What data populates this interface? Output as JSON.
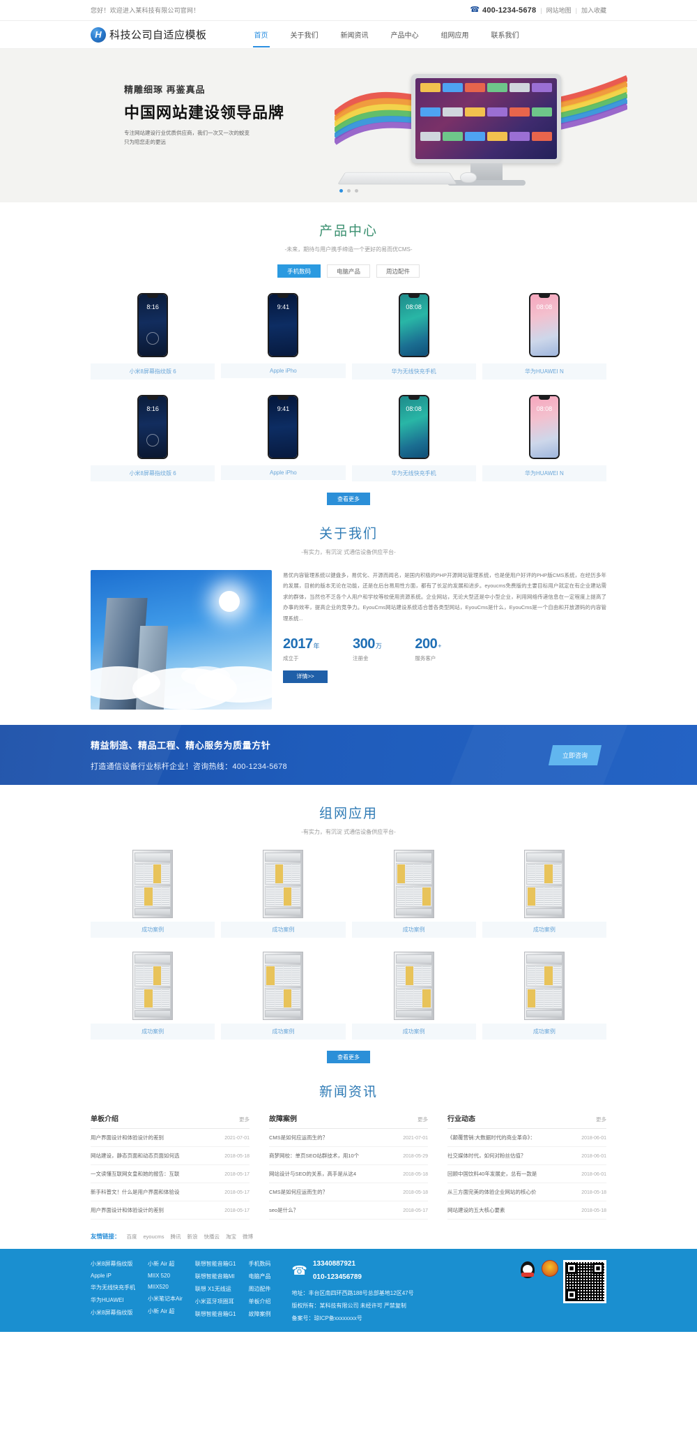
{
  "topbar": {
    "welcome": "您好！欢迎进入某科技有限公司官网！",
    "phone_icon": "phone-icon",
    "phone": "400-1234-5678",
    "sitemap": "网站地图",
    "favorite": "加入收藏",
    "sep": "|"
  },
  "header": {
    "logo_mark": "H",
    "logo_text": "科技公司自适应模板",
    "nav": [
      {
        "label": "首页",
        "active": true
      },
      {
        "label": "关于我们",
        "active": false
      },
      {
        "label": "新闻资讯",
        "active": false
      },
      {
        "label": "产品中心",
        "active": false
      },
      {
        "label": "组网应用",
        "active": false
      },
      {
        "label": "联系我们",
        "active": false
      }
    ]
  },
  "banner": {
    "subtitle": "精雕细琢 再鉴真品",
    "title": "中国网站建设领导品牌",
    "desc_line1": "专注网站建设行业优质供应商，我们一次又一次的蜕变",
    "desc_line2": "只为陪您走的更远",
    "screen_time": "",
    "dots": 3,
    "active_dot": 0
  },
  "products": {
    "title": "产品中心",
    "subtitle": "-未来，期待与用户携手缔造一个更好的易而优CMS-",
    "tabs": [
      {
        "label": "手机数码",
        "active": true
      },
      {
        "label": "电脑产品",
        "active": false
      },
      {
        "label": "周边配件",
        "active": false
      }
    ],
    "items": [
      {
        "name": "小米8屏幕指纹版 6",
        "style": "ph-xiaomi",
        "time": "8:16"
      },
      {
        "name": "Apple iPho",
        "style": "ph-iphone",
        "time": "9:41"
      },
      {
        "name": "华为无线快充手机",
        "style": "ph-huawei1",
        "time": "08:08"
      },
      {
        "name": "华为HUAWEI N",
        "style": "ph-huawei2",
        "time": "08:08"
      },
      {
        "name": "小米8屏幕指纹版 6",
        "style": "ph-xiaomi",
        "time": "8:16"
      },
      {
        "name": "Apple iPho",
        "style": "ph-iphone",
        "time": "9:41"
      },
      {
        "name": "华为无线快充手机",
        "style": "ph-huawei1",
        "time": "08:08"
      },
      {
        "name": "华为HUAWEI N",
        "style": "ph-huawei2",
        "time": "08:08"
      }
    ],
    "more": "查看更多"
  },
  "about": {
    "title": "关于我们",
    "subtitle": "-有实力，有沉淀 式通信设备供应平台-",
    "paragraph": "易优内容管理系统以键盘多，易优化、开源而闻名，是国内积极的PHP开源网站管理系统，也是使用户好评的PHP版CMS系统，在经历多年的发展，目前的版本无论在功能，还是在后台易用性方面，都有了长足的发展和进步。eyoucms免费版的主要目标用户就定在有企业建站需求的群体，当然也不乏各个人用户和学校等校使用资源系统。企业网站，无论大型还是中小型企业，利用网络传递信息在一定程度上提高了办事的效率，提高企业的竞争力。EyouCms网站建设系统适合普各类型网站，EyouCms是什么，EyouCms是一个自由和开放源码的内容管理系统...",
    "stats": [
      {
        "number": "2017",
        "unit": "年",
        "label": "成立于"
      },
      {
        "number": "300",
        "unit": "万",
        "label": "注册金"
      },
      {
        "number": "200",
        "unit": "+",
        "label": "服务客户"
      }
    ],
    "detail_btn": "详情>>"
  },
  "cta": {
    "line1": "精益制造、精品工程、精心服务为质量方针",
    "line2": "打造通信设备行业标杆企业！咨询热线：400-1234-5678",
    "button": "立即咨询"
  },
  "network": {
    "title": "组网应用",
    "subtitle": "-有实力，有沉淀 式通信设备供应平台-",
    "items": [
      {
        "name": "成功案例"
      },
      {
        "name": "成功案例"
      },
      {
        "name": "成功案例"
      },
      {
        "name": "成功案例"
      },
      {
        "name": "成功案例"
      },
      {
        "name": "成功案例"
      },
      {
        "name": "成功案例"
      },
      {
        "name": "成功案例"
      }
    ],
    "more": "查看更多"
  },
  "news": {
    "title": "新闻资讯",
    "more_label": "更多",
    "columns": [
      {
        "title": "单板介绍",
        "items": [
          {
            "title": "用户界面设计和体验设计的差别",
            "date": "2021-07-01"
          },
          {
            "title": "网站建设，静态页面和动态页面如何选",
            "date": "2018-05-18"
          },
          {
            "title": "一文读懂互联网女皇和她的报告：互联",
            "date": "2018-05-17"
          },
          {
            "title": "新手科普文！什么是用户界面和体验设",
            "date": "2018-05-17"
          },
          {
            "title": "用户界面设计和体验设计的差别",
            "date": "2018-05-17"
          }
        ]
      },
      {
        "title": "故障案例",
        "items": [
          {
            "title": "CMS是如何应运而生的？",
            "date": "2021-07-01"
          },
          {
            "title": "商梦网校：单页SEO站群技术，用10个",
            "date": "2018-05-29"
          },
          {
            "title": "网站设计与SEO的关系，高手是从这4",
            "date": "2018-05-18"
          },
          {
            "title": "CMS是如何应运而生的？",
            "date": "2018-05-18"
          },
          {
            "title": "seo是什么？",
            "date": "2018-05-17"
          }
        ]
      },
      {
        "title": "行业动态",
        "items": [
          {
            "title": "《颠覆营销:大数据时代的商业革命》：",
            "date": "2018-06-01"
          },
          {
            "title": "社交媒体时代，如何对粉丝估值？",
            "date": "2018-06-01"
          },
          {
            "title": "回顾中国饮料40年发展史，总有一款是",
            "date": "2018-06-01"
          },
          {
            "title": "从三方面完美的体验企业网站的核心价",
            "date": "2018-05-18"
          },
          {
            "title": "网站建设的五大核心要素",
            "date": "2018-05-18"
          }
        ]
      }
    ]
  },
  "friends": {
    "label": "友情链接：",
    "links": [
      "百度",
      "eyoucms",
      "腾讯",
      "新浪",
      "快播云",
      "淘宝",
      "微博"
    ]
  },
  "footer": {
    "link_columns": [
      [
        "小米8屏幕指纹版",
        "Apple iP",
        "华为无线快充手机",
        "华为HUAWEI",
        "小米8屏幕指纹版"
      ],
      [
        "小新 Air 超",
        "MIIX 520",
        "MIIX520",
        "小米笔记本Air",
        "小新 Air 超"
      ],
      [
        "联想智能音箱G1",
        "联想智能音箱MI",
        "联想 X1无线运",
        "小米蓝牙项圈耳",
        "联想智能音箱G1"
      ],
      [
        "手机数码",
        "电脑产品",
        "周边配件",
        "单板介绍",
        "故障案例"
      ]
    ],
    "phone_icon": "phone-call-icon",
    "phones": [
      "13340887921",
      "010-123456789"
    ],
    "address": "地址：丰台区南四环西路188号总部基地12区47号",
    "copyright": "版权所有：某科技有限公司  未经许可 严禁复制",
    "icp": "备案号：琼ICP备xxxxxxxx号",
    "badges": [
      "qq-icon",
      "gov-seal-icon",
      "qr-code"
    ]
  },
  "colors": {
    "accent_blue": "#2b8fd8",
    "brand_blue": "#1a8fd0",
    "green": "#3a8f6f",
    "deep_blue": "#1f5fa8"
  }
}
